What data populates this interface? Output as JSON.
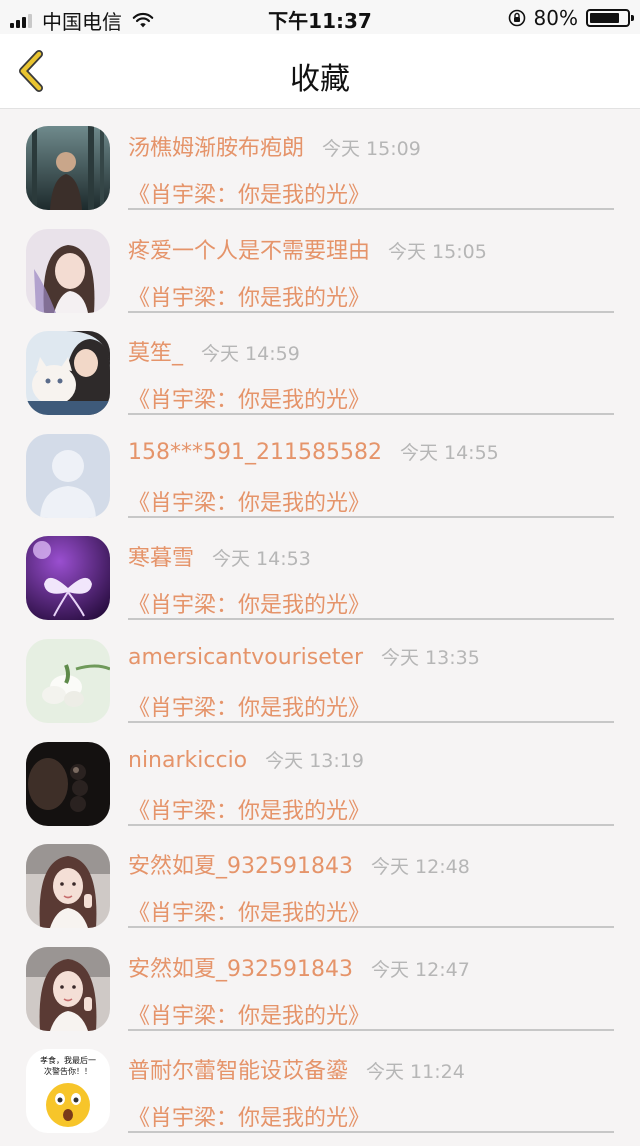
{
  "status_bar": {
    "carrier": "中国电信",
    "time": "下午11:37",
    "battery_percent": "80%",
    "battery_level": 0.8,
    "signal_bars_filled": 3,
    "signal_bars_total": 4
  },
  "nav": {
    "title": "收藏",
    "back_icon": "chevron-left-icon",
    "accent_color": "#e9c430"
  },
  "colors": {
    "name_text": "#e5946a",
    "time_text": "#b6b6b6",
    "background": "#f6f4f4"
  },
  "favorites": [
    {
      "name": "汤樵姆渐胺布疱朗",
      "time": "今天 15:09",
      "work": "《肖宇梁：你是我的光》",
      "avatar": "forest-photo-avatar"
    },
    {
      "name": "疼爱一个人是不需要理由",
      "time": "今天 15:05",
      "work": "《肖宇梁：你是我的光》",
      "avatar": "girl-photo-avatar"
    },
    {
      "name": "莫笙_",
      "time": "今天 14:59",
      "work": "《肖宇梁：你是我的光》",
      "avatar": "girl-with-cat-avatar"
    },
    {
      "name": "158***591_211585582",
      "time": "今天 14:55",
      "work": "《肖宇梁：你是我的光》",
      "avatar": "default-user-avatar"
    },
    {
      "name": "寒暮雪",
      "time": "今天 14:53",
      "work": "《肖宇梁：你是我的光》",
      "avatar": "purple-butterfly-avatar"
    },
    {
      "name": "amersicantvouriseter",
      "time": "今天 13:35",
      "work": "《肖宇梁：你是我的光》",
      "avatar": "white-flower-avatar"
    },
    {
      "name": "ninarkiccio",
      "time": "今天 13:19",
      "work": "《肖宇梁：你是我的光》",
      "avatar": "dark-photo-avatar"
    },
    {
      "name": "安然如夏_932591843",
      "time": "今天 12:48",
      "work": "《肖宇梁：你是我的光》",
      "avatar": "girl-selfie-avatar"
    },
    {
      "name": "安然如夏_932591843",
      "time": "今天 12:47",
      "work": "《肖宇梁：你是我的光》",
      "avatar": "girl-selfie-avatar"
    },
    {
      "name": "普耐尔蕾智能设苡备鎏",
      "time": "今天 11:24",
      "work": "《肖宇梁：你是我的光》",
      "avatar": "meme-emoji-avatar",
      "avatar_caption": "孝食，我最后一次警告你！！"
    }
  ]
}
